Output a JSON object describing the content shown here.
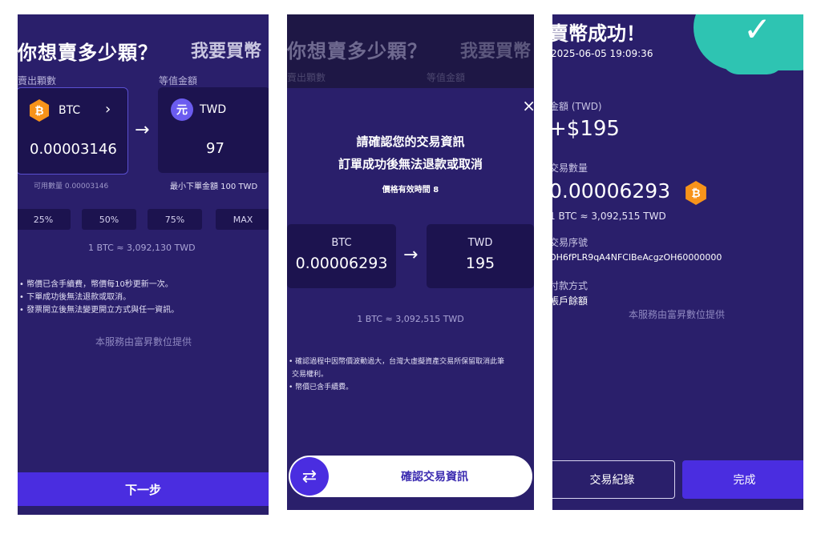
{
  "screen1": {
    "title": "你想賣多少顆？",
    "title_alt": "我要買幣",
    "sell_label": "賣出顆數",
    "equiv_label": "等值金額",
    "from_coin": "BTC",
    "from_amount": "0.00003146",
    "to_coin": "TWD",
    "to_amount": "97",
    "twd_badge": "元",
    "available": "可用數量 0.00003146",
    "min_order": "最小下單金額 100 TWD",
    "percent_buttons": [
      "25%",
      "50%",
      "75%",
      "MAX"
    ],
    "rate": "1 BTC ≈ 3,092,130  TWD",
    "notes": [
      "幣價已含手續費，幣價每10秒更新一次。",
      "下單成功後無法退款或取消。",
      "發票開立後無法變更開立方式與任一資訊。"
    ],
    "provider": "本服務由富昇數位提供",
    "next_button": "下一步"
  },
  "screen2": {
    "bg_title": "你想賣多少顆？",
    "bg_title_alt": "我要買幣",
    "bg_sell_label": "賣出顆數",
    "bg_equiv_label": "等值金額",
    "close": "×",
    "confirm_line1": "請確認您的交易資訊",
    "confirm_line2": "訂單成功後無法退款或取消",
    "valid_time": "價格有效時間 8",
    "from_coin": "BTC",
    "from_amount": "0.00006293",
    "to_coin": "TWD",
    "to_amount": "195",
    "rate": "1 BTC ≈ 3,092,515  TWD",
    "notes": [
      "確認過程中因幣價波動過大，台灣大虛擬資產交易所保留取消此筆",
      "交易權利。",
      "幣價已含手續費。"
    ],
    "swipe_label": "確認交易資訊"
  },
  "screen3": {
    "title": "賣幣成功！",
    "datetime": "2025-06-05 19:09:36",
    "amount_label": "金額 (TWD)",
    "amount_value": "+$195",
    "qty_label": "交易數量",
    "qty_value": "0.00006293",
    "rate": "1 BTC ≈ 3,092,515  TWD",
    "serial_label": "交易序號",
    "serial_value": "OH6fPLR9qA4NFClBeAcgzOH60000000",
    "payment_label": "付款方式",
    "payment_value": "帳戶餘額",
    "provider": "本服務由富昇數位提供",
    "history_button": "交易紀錄",
    "done_button": "完成"
  },
  "icons": {
    "btc": "bitcoin-icon",
    "twd": "twd-icon",
    "chevron": "chevron-right-icon",
    "arrow": "arrow-right-icon",
    "close": "close-icon",
    "swap": "swap-icon",
    "check": "check-icon"
  },
  "colors": {
    "background": "#2a1f6b",
    "card": "#1c134f",
    "accent": "#4a2de0",
    "btc": "#f7931a",
    "success": "#2ec4b2"
  }
}
